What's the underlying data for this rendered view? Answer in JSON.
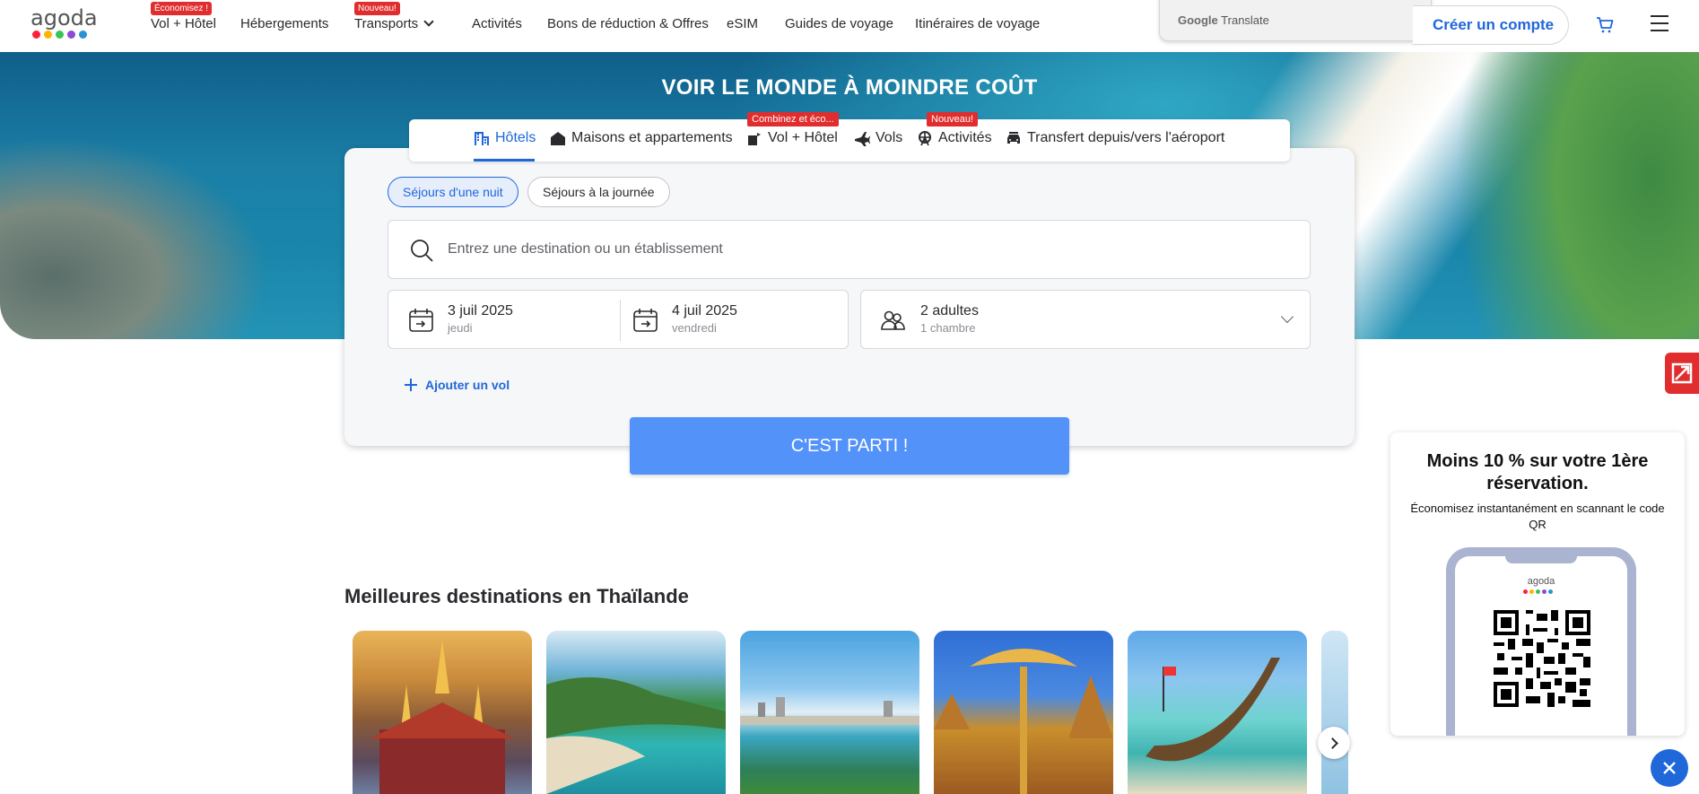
{
  "brand": {
    "logo_text": "agoda",
    "dot_colors": [
      "#ff1f3d",
      "#ffb400",
      "#37c45a",
      "#8b4bd8",
      "#2a93d5"
    ]
  },
  "nav": {
    "items": [
      {
        "label": "Vol + Hôtel",
        "badge": "Économisez !"
      },
      {
        "label": "Hébergements"
      },
      {
        "label": "Transports",
        "badge": "Nouveau!"
      },
      {
        "label": "Activités"
      },
      {
        "label": "Bons de réduction & Offres"
      },
      {
        "label": "eSIM"
      },
      {
        "label": "Guides de voyage"
      },
      {
        "label": "Itinéraires de voyage"
      }
    ],
    "translate": {
      "google": "Google",
      "translate": "Translate"
    },
    "create_account": "Créer un compte"
  },
  "hero": {
    "title": "VOIR LE MONDE À MOINDRE COÛT"
  },
  "search_tabs": [
    {
      "label": "Hôtels",
      "active": true
    },
    {
      "label": "Maisons et appartements"
    },
    {
      "label": "Vol + Hôtel",
      "badge": "Combinez et éco..."
    },
    {
      "label": "Vols"
    },
    {
      "label": "Activités",
      "badge": "Nouveau!"
    },
    {
      "label": "Transfert depuis/vers l'aéroport"
    }
  ],
  "search": {
    "stay_types": [
      "Séjours d'une nuit",
      "Séjours à la journée"
    ],
    "destination_placeholder": "Entrez une destination ou un établissement",
    "checkin": {
      "date": "3 juil 2025",
      "day": "jeudi"
    },
    "checkout": {
      "date": "4 juil 2025",
      "day": "vendredi"
    },
    "guests": {
      "adults": "2 adultes",
      "rooms": "1 chambre"
    },
    "add_flight": "Ajouter un vol",
    "submit": "C'EST PARTI !"
  },
  "destinations": {
    "title": "Meilleures destinations en Thaïlande"
  },
  "promo": {
    "title": "Moins 10 % sur votre 1ère réservation.",
    "text": "Économisez instantanément en scannant le code QR",
    "phone_logo": "agoda"
  },
  "colors": {
    "accent": "#2067da",
    "button": "#5392f9",
    "badge": "#e12d2d"
  }
}
